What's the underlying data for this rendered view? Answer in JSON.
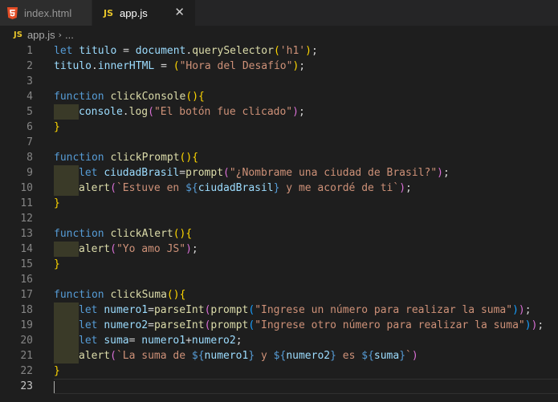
{
  "tabs": [
    {
      "label": "index.html",
      "icon": "html5-icon"
    },
    {
      "label": "app.js",
      "icon": "js-icon",
      "active": true
    }
  ],
  "tab_icon_text": "JS",
  "close_glyph": "✕",
  "breadcrumb": {
    "icon_text": "JS",
    "file": "app.js",
    "separator": "›",
    "more": "..."
  },
  "line_numbers": [
    "1",
    "2",
    "3",
    "4",
    "5",
    "6",
    "7",
    "8",
    "9",
    "10",
    "11",
    "12",
    "13",
    "14",
    "15",
    "16",
    "17",
    "18",
    "19",
    "20",
    "21",
    "22",
    "23"
  ],
  "code": {
    "l1": [
      "let",
      "titulo",
      " = ",
      "document",
      ".",
      "querySelector",
      "(",
      "'h1'",
      ");"
    ],
    "l2": [
      "titulo",
      ".",
      "innerHTML",
      " = ",
      "(",
      "\"Hora del Desafío\"",
      ");"
    ],
    "l4": [
      "function",
      " ",
      "clickConsole",
      "(){"
    ],
    "l5": [
      "console",
      ".",
      "log",
      "(",
      "\"El botón fue clicado\"",
      ");"
    ],
    "l6": [
      "}"
    ],
    "l8": [
      "function",
      " ",
      "clickPrompt",
      "(){"
    ],
    "l9": [
      "let",
      " ",
      "ciudadBrasil",
      "=",
      "prompt",
      "(",
      "\"¿Nombrame una ciudad de Brasil?\"",
      ");"
    ],
    "l10": [
      "alert",
      "(",
      "`Estuve en ",
      "${",
      "ciudadBrasil",
      "}",
      " y me acordé de ti`",
      ");"
    ],
    "l11": [
      "}"
    ],
    "l13": [
      "function",
      " ",
      "clickAlert",
      "(){"
    ],
    "l14": [
      "alert",
      "(",
      "\"Yo amo JS\"",
      ");"
    ],
    "l15": [
      "}"
    ],
    "l17": [
      "function",
      " ",
      "clickSuma",
      "(){"
    ],
    "l18": [
      "let",
      " ",
      "numero1",
      "=",
      "parseInt",
      "(",
      "prompt",
      "(",
      "\"Ingrese un número para realizar la suma\"",
      "));"
    ],
    "l19": [
      "let",
      " ",
      "numero2",
      "=",
      "parseInt",
      "(",
      "prompt",
      "(",
      "\"Ingrese otro número para realizar la suma\"",
      "));"
    ],
    "l20": [
      "let",
      " ",
      "suma",
      "= ",
      "numero1",
      "+",
      "numero2",
      ";"
    ],
    "l21": [
      "alert",
      "(",
      "`La suma de ",
      "${",
      "numero1",
      "}",
      " y ",
      "${",
      "numero2",
      "}",
      " es ",
      "${",
      "suma",
      "}",
      "`",
      ")"
    ],
    "l22": [
      "}"
    ]
  },
  "colors": {
    "background": "#1e1e1e",
    "keyword": "#569cd6",
    "variable": "#9cdcfe",
    "function": "#dcdcaa",
    "string": "#ce9178",
    "bracket_level1": "#ffd700",
    "bracket_level2": "#da70d6",
    "js_icon": "#e8c52a",
    "html_icon": "#e44d26"
  }
}
